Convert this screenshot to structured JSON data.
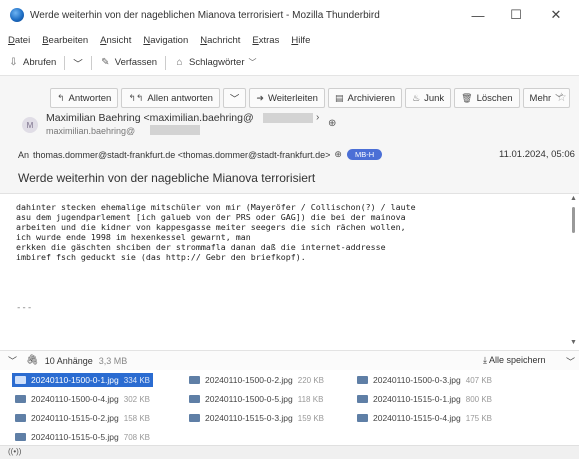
{
  "window": {
    "title": "Werde weiterhin von der nageblichen Mianova terrorisiert - Mozilla Thunderbird",
    "minimize_glyph": "—",
    "maximize_glyph": "☐",
    "close_glyph": "✕"
  },
  "menubar": {
    "items": [
      "Datei",
      "Bearbeiten",
      "Ansicht",
      "Navigation",
      "Nachricht",
      "Extras",
      "Hilfe"
    ]
  },
  "toolbar": {
    "fetch_label": "Abrufen",
    "compose_label": "Verfassen",
    "tags_label": "Schlagwörter"
  },
  "actions": {
    "reply": "Antworten",
    "reply_all": "Allen antworten",
    "forward": "Weiterleiten",
    "archive": "Archivieren",
    "junk": "Junk",
    "delete": "Löschen",
    "more": "Mehr"
  },
  "message": {
    "avatar_initial": "M",
    "from_name": "Maximilian Baehring <maximilian.baehring@",
    "from_email": "maximilian.baehring@",
    "to_label": "An",
    "to_address": "thomas.dommer@stadt-frankfurt.de <thomas.dommer@stadt-frankfurt.de>",
    "badge": "MB-H",
    "date": "11.01.2024, 05:06",
    "subject": "Werde weiterhin von der nagebliche Mianova terrorisiert",
    "body": "dahinter stecken ehemalige mitschüler von mir (Mayeröfer / Collischon(?) / laute\nasu dem jugendparlement [ich galueb von der PRS oder GAG]) die bei der mainova\narbeiten und die kidner von kappesgasse meiter seegers die sich rächen wollen,\nich wurde ende 1998 im hexenkessel gewarnt, man\nerkken die gäschten shciben der strommafla danan daß die internet-addresse\nimbiref fsch geduckt sie (das http:// Gebr den briefkopf).",
    "signature": "---"
  },
  "attachments": {
    "count_label": "10 Anhänge",
    "total_size": "3,3 MB",
    "save_all_label": "Alle speichern",
    "items": [
      {
        "name": "20240110-1500-0-1.jpg",
        "size": "334 KB"
      },
      {
        "name": "20240110-1500-0-2.jpg",
        "size": "220 KB"
      },
      {
        "name": "20240110-1500-0-3.jpg",
        "size": "407 KB"
      },
      {
        "name": "20240110-1500-0-4.jpg",
        "size": "302 KB"
      },
      {
        "name": "20240110-1500-0-5.jpg",
        "size": "118 KB"
      },
      {
        "name": "20240110-1515-0-1.jpg",
        "size": "800 KB"
      },
      {
        "name": "20240110-1515-0-2.jpg",
        "size": "158 KB"
      },
      {
        "name": "20240110-1515-0-3.jpg",
        "size": "159 KB"
      },
      {
        "name": "20240110-1515-0-4.jpg",
        "size": "175 KB"
      },
      {
        "name": "20240110-1515-0-5.jpg",
        "size": "708 KB"
      }
    ]
  },
  "statusbar": {
    "icon": "((•))"
  }
}
